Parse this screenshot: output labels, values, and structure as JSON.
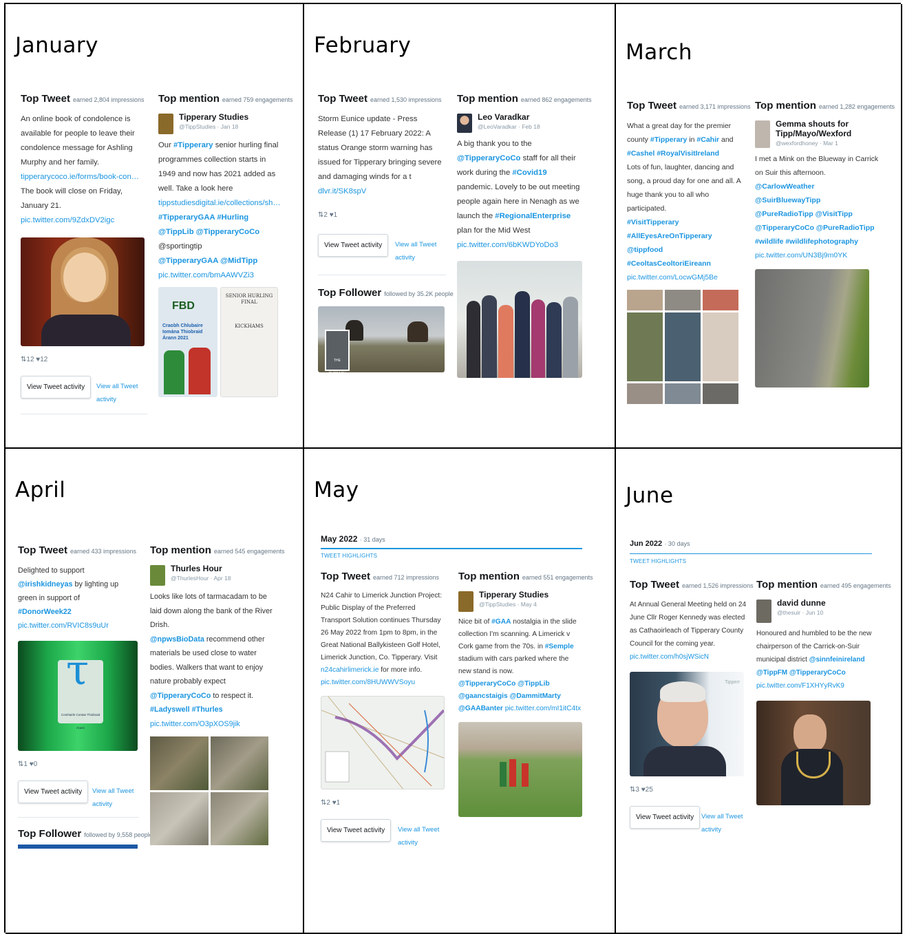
{
  "labels": {
    "top_tweet": "Top Tweet",
    "top_mention": "Top mention",
    "top_follower": "Top Follower",
    "view_tweet_activity": "View Tweet activity",
    "view_all_tweet_activity": "View all Tweet activity",
    "tweet_highlights": "TWEET HIGHLIGHTS"
  },
  "months": [
    {
      "name": "January",
      "tweet_earned": "earned 2,804 impressions",
      "tweet_text": "An online book of condolence is available for people to leave their condolence message for Ashling Murphy and her family.",
      "tweet_link": "tipperarycoco.ie/forms/book-con…",
      "tweet_text2": "The book will close on Friday, January 21.",
      "tweet_pic": "pic.twitter.com/9ZdxDV2igc",
      "tweet_stats": "⇅12  ♥12",
      "mention_earned": "earned 759 engagements",
      "mention_user": "Tipperary Studies",
      "mention_handle": "@TippStudies · Jan 18",
      "mention_text1": "Our",
      "mention_tag1": "#Tipperary",
      "mention_text2": "senior hurling final programmes collection starts in 1949 and now has 2021 added as well. Take a look here",
      "mention_link": "tippstudiesdigital.ie/collections/sh…",
      "mention_tags": "#TipperaryGAA #Hurling",
      "mention_tags2": "@TippLib @TipperaryCoCo",
      "mention_plain": "@sportingtip",
      "mention_tags3": "@TipperaryGAA @MidTipp",
      "mention_pic": "pic.twitter.com/bmAAWVZi3",
      "poster_fbd": "FBD",
      "poster_title": "Craobh Chlubaire Iomána Thiobraid Árann 2021",
      "programme_title": "SENIOR HURLING FINAL",
      "programme_team": "KICKHAMS"
    },
    {
      "name": "February",
      "tweet_earned": "earned 1,530 impressions",
      "tweet_text": "Storm Eunice update - Press Release (1) 17 February 2022: A status Orange storm warning has issued for Tipperary bringing severe and damaging winds for a t",
      "tweet_link": "dlvr.it/SK8spV",
      "tweet_stats": "⇅2  ♥1",
      "mention_earned": "earned 862 engagements",
      "mention_user": "Leo Varadkar",
      "mention_handle": "@LeoVaradkar · Feb 18",
      "mention_text1": "A big thank you to the",
      "mention_tag1": "@TipperaryCoCo",
      "mention_text2": "staff for all their work during the",
      "mention_tag2": "#Covid19",
      "mention_text3": "pandemic. Lovely to be out meeting people again here in Nenagh as we launch the",
      "mention_tag3": "#RegionalEnterprise",
      "mention_text4": "plan for the Mid West",
      "mention_pic": "pic.twitter.com/6bKWDYoDo3",
      "follower_earned": "followed by 35.2K people",
      "follower_badge": "THE CURRAGH"
    },
    {
      "name": "March",
      "tweet_earned": "earned 3,171 impressions",
      "tweet_text1": "What a great day for the premier county",
      "tweet_tags1": "#Tipperary",
      "tweet_text2": "in",
      "tweet_tags2": "#Cahir",
      "tweet_text3": "and",
      "tweet_tags3": "#Cashel",
      "tweet_tags4": "#RoyalVisitIreland",
      "tweet_text4": "Lots of fun, laughter, dancing and song, a proud day for one and all. A huge thank you to all who participated.",
      "tweet_tags5": "#VisitTipperary #AllEyesAreOnTipperary @tippfood #CeoltasCeoltoriEireann",
      "tweet_pic": "pic.twitter.com/LocwGMj5Be",
      "mention_earned": "earned 1,282 engagements",
      "mention_user": "Gemma shouts for Tipp/Mayo/Wexford",
      "mention_handle": "@wexfordhoney · Mar 1",
      "mention_text": "I met a Mink on the Blueway in Carrick on Suir this afternoon.",
      "mention_tags": "@CarlowWeather @SuirBluewayTipp @PureRadioTipp @VisitTipp @TipperaryCoCo @PureRadioTipp #wildlife #wildlifephotography",
      "mention_pic": "pic.twitter.com/UN3Bj9m0YK"
    },
    {
      "name": "April",
      "tweet_earned": "earned 433 impressions",
      "tweet_text1": "Delighted to support",
      "tweet_tag1": "@irishkidneyas",
      "tweet_text2": "by lighting up green in support of",
      "tweet_tag2": "#DonorWeek22",
      "tweet_pic": "pic.twitter.com/RVIC8s9uUr",
      "tweet_stats": "⇅1  ♥0",
      "sign_text": "Comhairle Contae Thiobraid Árann",
      "mention_earned": "earned 545 engagements",
      "mention_user": "Thurles Hour",
      "mention_handle": "@ThurlesHour · Apr 18",
      "mention_text1": "Looks like lots of tarmacadam to be laid down along the bank of the River Drish.",
      "mention_tag1": "@npwsBioData",
      "mention_text2": "recommend other materials be used close to water bodies. Walkers that want to enjoy nature probably expect",
      "mention_tag2": "@TipperaryCoCo",
      "mention_text3": "to respect it.",
      "mention_tags": "#Ladyswell #Thurles",
      "mention_pic": "pic.twitter.com/O3pXOS9jik",
      "follower_earned": "followed by 9,558 people"
    },
    {
      "name": "May",
      "period": "May 2022",
      "period_days": "· 31 days",
      "tweet_earned": "earned 712 impressions",
      "tweet_text": "N24 Cahir to Limerick Junction Project: Public Display of the Preferred Transport Solution continues Thursday 26 May 2022 from 1pm to 8pm, in the Great National Ballykisteen Golf Hotel, Limerick Junction, Co. Tipperary. Visit",
      "tweet_link": "n24cahirlimerick.ie",
      "tweet_text2": "for more info.",
      "tweet_pic": "pic.twitter.com/8HUWWVSoyu",
      "tweet_stats": "⇅2  ♥1",
      "mention_earned": "earned 551 engagements",
      "mention_user": "Tipperary Studies",
      "mention_handle": "@TippStudies · May 4",
      "mention_text1": "Nice bit of",
      "mention_tag1": "#GAA",
      "mention_text2": "nostalgia in the slide collection I'm scanning. A Limerick v Cork game from the 70s. in",
      "mention_tag2": "#Semple",
      "mention_text3": "stadium with cars parked where the new stand is now.",
      "mention_tags": "@TipperaryCoCo @TippLib @gaancstaigis @DammitMarty @GAABanter",
      "mention_pic": "pic.twitter.com/mI1itC4tx"
    },
    {
      "name": "June",
      "period": "Jun 2022",
      "period_days": "· 30 days",
      "tweet_earned": "earned 1,526 impressions",
      "tweet_text": "At Annual General Meeting held on 24 June Cllr Roger Kennedy was elected as Cathaoirleach of Tipperary County Council for the coming year.",
      "tweet_pic": "pic.twitter.com/h0sjWSicN",
      "tweet_stats": "⇅3  ♥25",
      "photo_watermark": "Tipperr",
      "mention_earned": "earned 495 engagements",
      "mention_user": "david dunne",
      "mention_handle": "@thesuir · Jun 10",
      "mention_text": "Honoured and humbled to be the new chairperson of the Carrick-on-Suir municipal district",
      "mention_tags": "@sinnfeinireland @TippFM @TipperaryCoCo",
      "mention_pic": "pic.twitter.com/F1XHYyRvK9"
    }
  ],
  "colors": {
    "link": "#1b95e0",
    "text": "#333333",
    "muted": "#657786",
    "border": "#000000"
  }
}
